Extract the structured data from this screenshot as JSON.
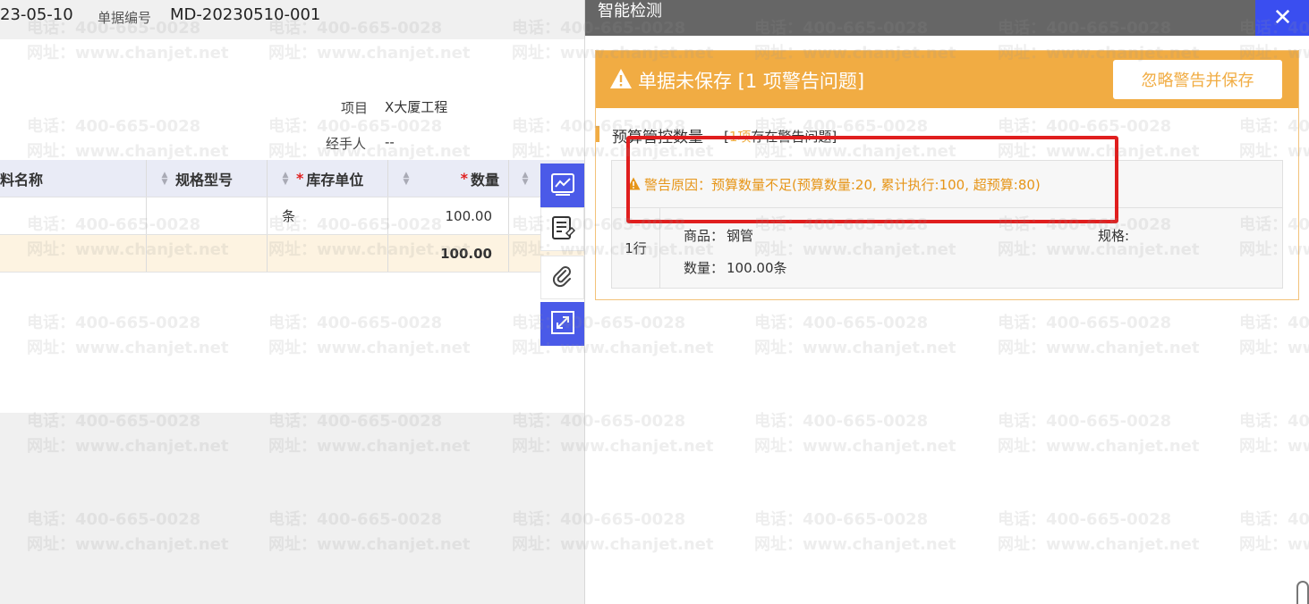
{
  "header": {
    "date_fragment": "23-05-10",
    "doc_no_label": "单据编号",
    "doc_no": "MD-20230510-001"
  },
  "fields": {
    "project_label": "项目",
    "project_value": "X大厦工程",
    "handler_label": "经手人",
    "handler_value": "--"
  },
  "grid": {
    "columns": [
      "料名称",
      "规格型号",
      "库存单位",
      "数量"
    ],
    "required_mark": "*",
    "rows": [
      {
        "name": "",
        "spec": "",
        "unit": "条",
        "qty": "100.00"
      }
    ],
    "total": {
      "qty": "100.00"
    }
  },
  "toolbar": {
    "items": [
      "trend-chart-icon",
      "note-list-icon",
      "attachment-icon",
      "expand-icon"
    ]
  },
  "panel": {
    "title": "智能检测",
    "close_glyph": "✕",
    "warning_banner": "单据未保存 [1 项警告问题]",
    "ignore_button": "忽略警告并保存",
    "section_title": "预算管控数量",
    "section_count_prefix": "[",
    "section_count_highlight": "1项",
    "section_count_suffix": "存在警告问题]",
    "reason_label": "警告原因：",
    "reason_text": "预算数量不足(预算数量:20, 累计执行:100, 超预算:80)",
    "row_label": "1行",
    "product_label": "商品：",
    "product_value": "钢管",
    "spec_label": "规格:",
    "qty_label": "数量：",
    "qty_value": "100.00条"
  },
  "watermark": {
    "phone": "电话：400-665-0028",
    "site": "网址：www.chanjet.net"
  },
  "colors": {
    "accent_blue": "#4a5ae8",
    "warning_orange": "#f1ac43",
    "highlight_red": "#e01e1e",
    "title_bar_gray": "#666666"
  }
}
